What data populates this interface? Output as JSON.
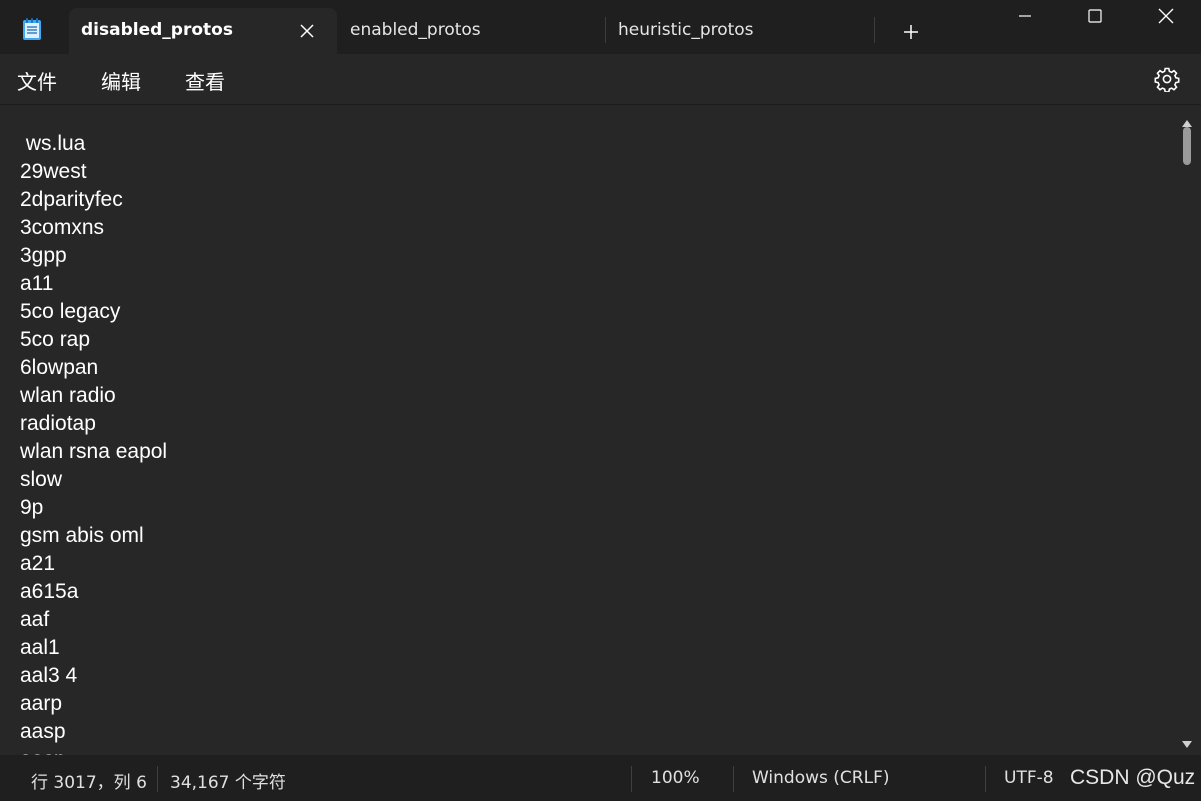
{
  "tabs": [
    {
      "label": "disabled_protos",
      "active": true
    },
    {
      "label": "enabled_protos",
      "active": false
    },
    {
      "label": "heuristic_protos",
      "active": false
    }
  ],
  "icons": {
    "app": "notepad-icon",
    "tab_close": "close-icon",
    "new_tab": "plus-icon",
    "minimize": "minimize-icon",
    "maximize": "maximize-icon",
    "close_window": "close-icon",
    "settings": "gear-icon"
  },
  "menu": {
    "file": "文件",
    "edit": "编辑",
    "view": "查看"
  },
  "editor": {
    "lines": [
      " ws.lua",
      "29west",
      "2dparityfec",
      "3comxns",
      "3gpp",
      "a11",
      "5co legacy",
      "5co rap",
      "6lowpan",
      "wlan radio",
      "radiotap",
      "wlan rsna eapol",
      "slow",
      "9p",
      "gsm abis oml",
      "a21",
      "a615a",
      "aaf",
      "aal1",
      "aal3 4",
      "aarp",
      "aasp",
      "aasp"
    ]
  },
  "status": {
    "position": "行 3017，列 6",
    "char_count": "34,167 个字符",
    "zoom": "100%",
    "line_ending": "Windows (CRLF)",
    "encoding": "UTF-8"
  },
  "watermark": "CSDN @Quz",
  "colors": {
    "titlebar_bg": "#1f1f1f",
    "editor_bg": "#272727",
    "text": "#ffffff"
  }
}
